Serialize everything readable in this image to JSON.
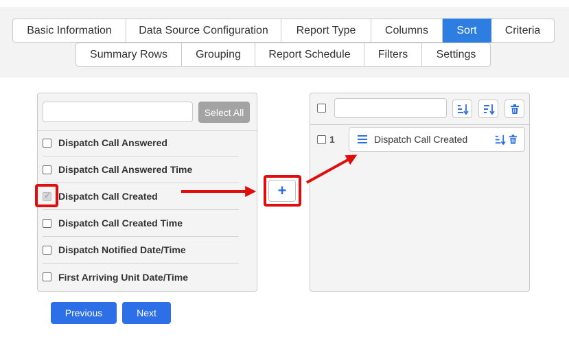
{
  "tabs": {
    "row1": [
      {
        "label": "Basic Information",
        "active": false
      },
      {
        "label": "Data Source Configuration",
        "active": false
      },
      {
        "label": "Report Type",
        "active": false
      },
      {
        "label": "Columns",
        "active": false
      },
      {
        "label": "Sort",
        "active": true
      },
      {
        "label": "Criteria",
        "active": false
      }
    ],
    "row2": [
      {
        "label": "Summary Rows",
        "active": false
      },
      {
        "label": "Grouping",
        "active": false
      },
      {
        "label": "Report Schedule",
        "active": false
      },
      {
        "label": "Filters",
        "active": false
      },
      {
        "label": "Settings",
        "active": false
      }
    ]
  },
  "available": {
    "search_value": "",
    "select_all_label": "Select All",
    "items": [
      {
        "label": "Dispatch Call Answered",
        "checked": false
      },
      {
        "label": "Dispatch Call Answered Time",
        "checked": false
      },
      {
        "label": "Dispatch Call Created",
        "checked": true
      },
      {
        "label": "Dispatch Call Created Time",
        "checked": false
      },
      {
        "label": "Dispatch Notified Date/Time",
        "checked": false
      },
      {
        "label": "First Arriving Unit Date/Time",
        "checked": false
      }
    ]
  },
  "add_button_label": "+",
  "sorted": {
    "search_value": "",
    "items": [
      {
        "index": "1",
        "label": "Dispatch Call Created"
      }
    ]
  },
  "icons": {
    "ascending": "sort-ascending-icon",
    "descending": "sort-descending-icon",
    "delete": "trash-icon",
    "drag": "drag-handle-icon"
  },
  "nav": {
    "previous_label": "Previous",
    "next_label": "Next"
  },
  "colors": {
    "accent": "#2d7ee0",
    "button": "#2d6fe6",
    "highlight": "#e00d0d",
    "disabled": "#a3a3a3"
  }
}
